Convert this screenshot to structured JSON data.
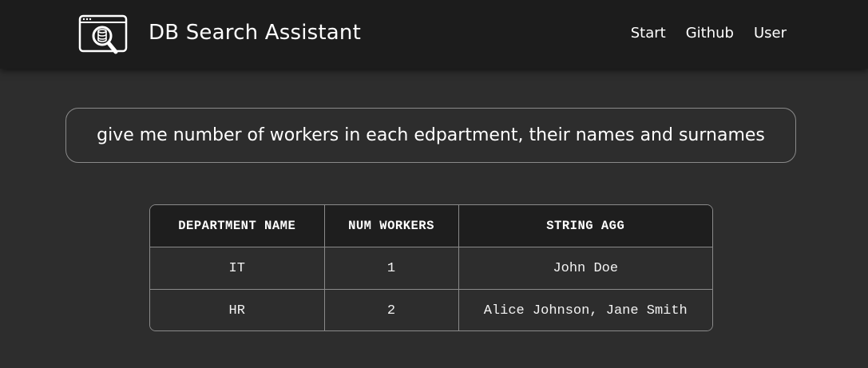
{
  "navbar": {
    "title": "DB Search Assistant",
    "logo_icon": "database-search-icon",
    "links": [
      "Start",
      "Github",
      "User"
    ]
  },
  "query": {
    "text": "give me number of workers in each edpartment, their names and surnames"
  },
  "results": {
    "columns": [
      "DEPARTMENT NAME",
      "NUM WORKERS",
      "STRING AGG"
    ],
    "rows": [
      [
        "IT",
        "1",
        "John Doe"
      ],
      [
        "HR",
        "2",
        "Alice Johnson, Jane Smith"
      ]
    ]
  },
  "colors": {
    "background": "#2d2d2d",
    "navbar": "#1c1c1c",
    "header_row": "#1e1e1e",
    "border": "#8a8a8a",
    "text": "#ffffff"
  }
}
